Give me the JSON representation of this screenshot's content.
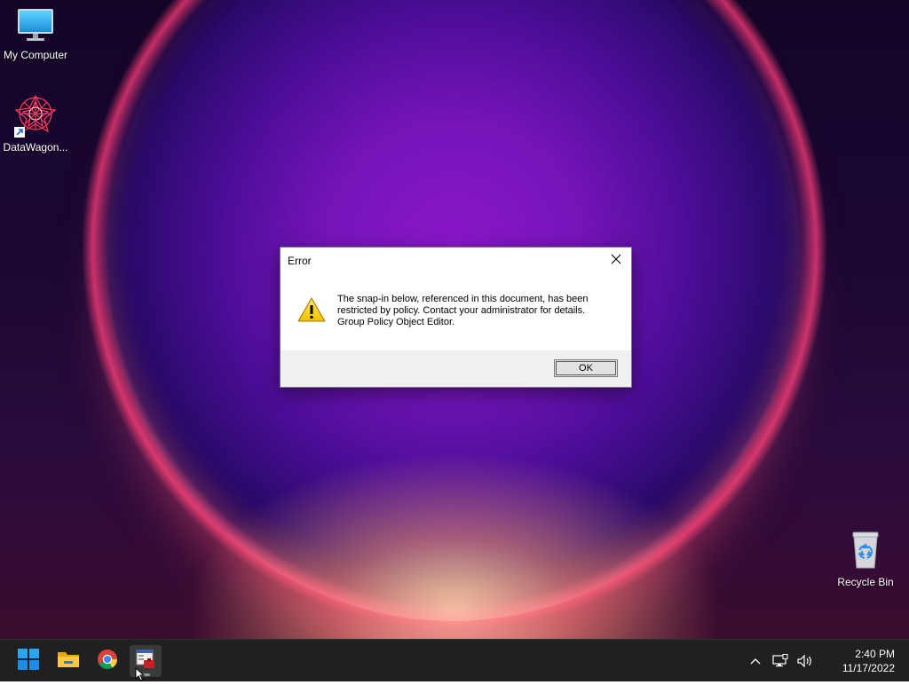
{
  "desktop": {
    "icons": [
      {
        "label": "My Computer",
        "icon": "monitor-icon"
      },
      {
        "label": "DataWagon...",
        "icon": "datawagon-icon",
        "shortcut": true
      },
      {
        "label": "Recycle Bin",
        "icon": "recycle-bin-icon"
      }
    ]
  },
  "dialog": {
    "title": "Error",
    "message_lines": [
      "The snap-in below, referenced in this document, has been",
      "restricted by policy. Contact your administrator for details.",
      "Group Policy Object Editor."
    ],
    "ok_label": "OK",
    "icon": "warning-icon",
    "close_icon": "close-icon"
  },
  "taskbar": {
    "pinned": [
      {
        "name": "start",
        "icon": "windows-start-icon"
      },
      {
        "name": "file-explorer",
        "icon": "folder-icon"
      },
      {
        "name": "chrome",
        "icon": "chrome-icon"
      },
      {
        "name": "mmc",
        "icon": "mmc-console-icon",
        "active": true
      }
    ],
    "tray": {
      "icons": [
        "chevron-up-icon",
        "network-icon",
        "volume-icon"
      ],
      "time": "2:40 PM",
      "date": "11/17/2022"
    }
  },
  "colors": {
    "taskbar": "#202020",
    "dialog_footer": "#f0f0f0",
    "windows_blue": "#1e90ff"
  }
}
